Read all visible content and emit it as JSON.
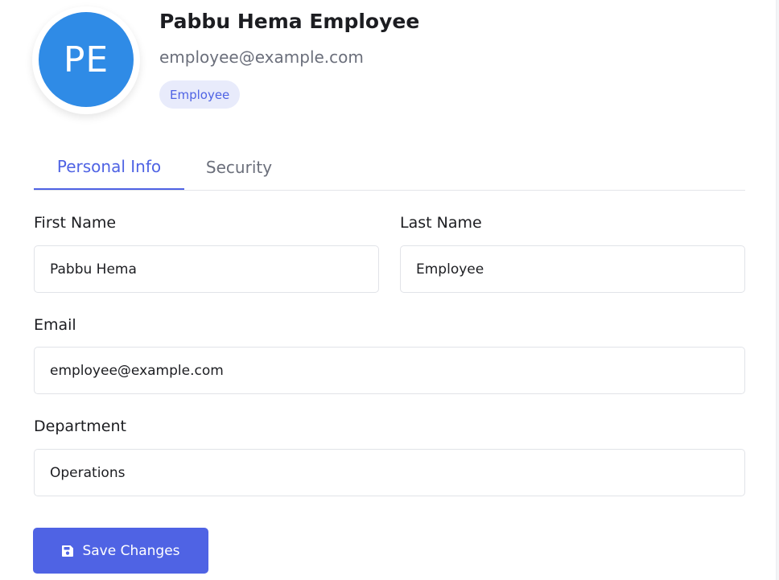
{
  "profile": {
    "initials": "PE",
    "full_name": "Pabbu Hema Employee",
    "email": "employee@example.com",
    "role": "Employee"
  },
  "tabs": [
    {
      "label": "Personal Info",
      "active": true
    },
    {
      "label": "Security",
      "active": false
    }
  ],
  "form": {
    "first_name": {
      "label": "First Name",
      "value": "Pabbu Hema"
    },
    "last_name": {
      "label": "Last Name",
      "value": "Employee"
    },
    "email": {
      "label": "Email",
      "value": "employee@example.com"
    },
    "department": {
      "label": "Department",
      "value": "Operations"
    }
  },
  "actions": {
    "save_label": "Save Changes",
    "save_icon": "floppy-disk-icon"
  },
  "colors": {
    "avatar_bg": "#2f8be6",
    "accent": "#4f63e4",
    "badge_bg": "#e8ebfb",
    "badge_text": "#4f63e4",
    "tab_inactive": "#6b6f7b",
    "button_text": "#ffffff"
  }
}
